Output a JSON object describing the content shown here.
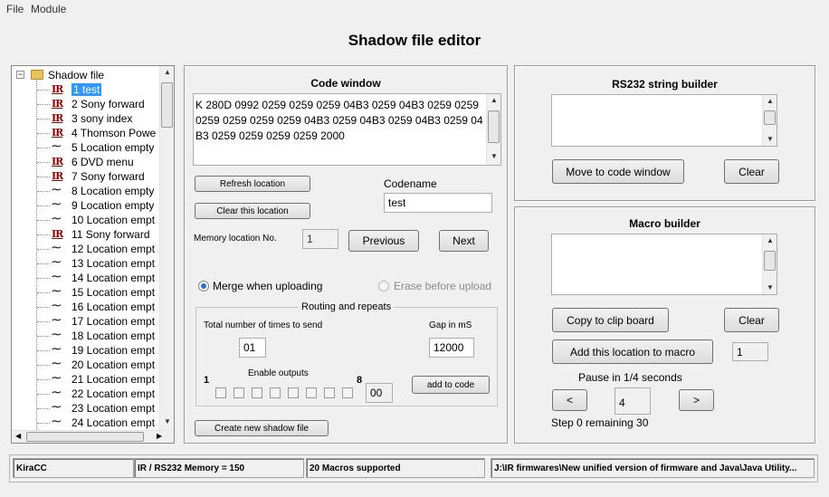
{
  "menu": {
    "file": "File",
    "module": "Module"
  },
  "title": "Shadow file editor",
  "tree": {
    "root": "Shadow file",
    "items": [
      {
        "icon": "ir-icon",
        "label": "1 test",
        "selected": true
      },
      {
        "icon": "ir-icon",
        "label": "2 Sony forward"
      },
      {
        "icon": "ir-icon",
        "label": "3 sony index"
      },
      {
        "icon": "ir-icon",
        "label": "4 Thomson Powe"
      },
      {
        "icon": "wave-icon",
        "label": "5 Location empty"
      },
      {
        "icon": "ir-icon",
        "label": "6 DVD menu"
      },
      {
        "icon": "ir-icon",
        "label": "7 Sony forward"
      },
      {
        "icon": "wave-icon",
        "label": "8 Location empty"
      },
      {
        "icon": "wave-icon",
        "label": "9 Location empty"
      },
      {
        "icon": "wave-icon",
        "label": "10 Location empt"
      },
      {
        "icon": "ir-icon",
        "label": "11 Sony forward"
      },
      {
        "icon": "wave-icon",
        "label": "12 Location empt"
      },
      {
        "icon": "wave-icon",
        "label": "13 Location empt"
      },
      {
        "icon": "wave-icon",
        "label": "14 Location empt"
      },
      {
        "icon": "wave-icon",
        "label": "15 Location empt"
      },
      {
        "icon": "wave-icon",
        "label": "16 Location empt"
      },
      {
        "icon": "wave-icon",
        "label": "17 Location empt"
      },
      {
        "icon": "wave-icon",
        "label": "18 Location empt"
      },
      {
        "icon": "wave-icon",
        "label": "19 Location empt"
      },
      {
        "icon": "wave-icon",
        "label": "20 Location empt"
      },
      {
        "icon": "wave-icon",
        "label": "21 Location empt"
      },
      {
        "icon": "wave-icon",
        "label": "22 Location empt"
      },
      {
        "icon": "wave-icon",
        "label": "23 Location empt"
      },
      {
        "icon": "wave-icon",
        "label": "24 Location empt"
      }
    ]
  },
  "code_window": {
    "title": "Code window",
    "code": "K 280D 0992 0259 0259 0259 04B3 0259 04B3 0259 0259 0259 0259 0259 0259 04B3 0259 04B3 0259 04B3 0259 04B3 0259 0259 0259 0259 2000",
    "refresh_label": "Refresh location",
    "clear_location_label": "Clear this location",
    "codename_label": "Codename",
    "codename_value": "test",
    "memory_label": "Memory location No.",
    "memory_value": "1",
    "previous_label": "Previous",
    "next_label": "Next",
    "merge_label": "Merge when uploading",
    "erase_label": "Erase before upload",
    "routing_title": "Routing and repeats",
    "times_label": "Total number of times to send",
    "times_value": "01",
    "gap_label": "Gap in mS",
    "gap_value": "12000",
    "outputs_label": "Enable outputs",
    "outputs_first": "1",
    "outputs_last": "8",
    "outputs_value": "00",
    "outputs_checked": [
      false,
      false,
      false,
      false,
      false,
      false,
      false,
      false
    ],
    "add_to_code_label": "add to code",
    "create_label": "Create new shadow file"
  },
  "rs232": {
    "title": "RS232 string builder",
    "text": "",
    "move_label": "Move to code window",
    "clear_label": "Clear"
  },
  "macro": {
    "title": "Macro builder",
    "text": "",
    "copy_label": "Copy to clip board",
    "clear_label": "Clear",
    "add_label": "Add this location to macro",
    "add_value": "1",
    "pause_label": "Pause in 1/4 seconds",
    "prev_symbol": "<",
    "next_symbol": ">",
    "pause_value": "4",
    "step_text": "Step 0 remaining 30"
  },
  "status": {
    "app": "KiraCC",
    "memory": "IR / RS232 Memory = 150",
    "macros": "20 Macros supported",
    "path": "J:\\IR firmwares\\New unified version of firmware and Java\\Java Utility..."
  }
}
